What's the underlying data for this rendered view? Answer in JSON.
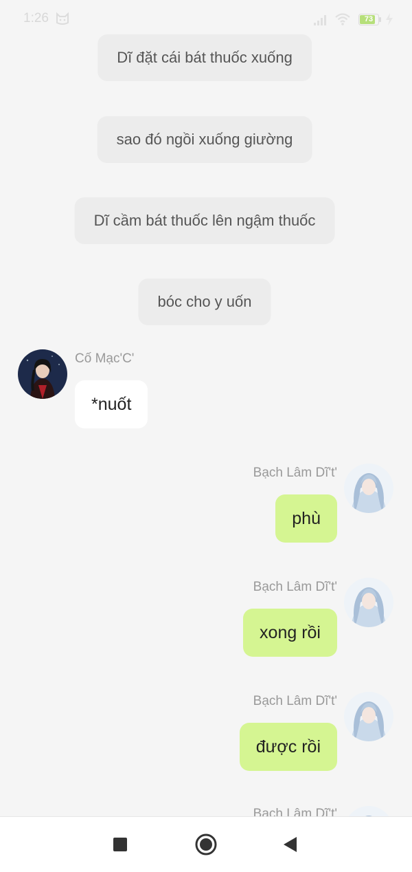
{
  "status_bar": {
    "time": "1:26",
    "battery_level": "73",
    "icons": [
      "cat-icon",
      "signal-icon",
      "wifi-icon",
      "battery-icon",
      "bolt-icon"
    ]
  },
  "system_messages": [
    "Dĩ đặt cái bát thuốc xuống",
    "sao đó ngồi xuống giường",
    "Dĩ cầm bát thuốc lên ngậm thuốc",
    "bóc cho y uốn"
  ],
  "messages": [
    {
      "sender": "Cố Mạc'C'",
      "text": "*nuốt",
      "direction": "incoming"
    },
    {
      "sender": "Bạch Lâm Dĩ't'",
      "text": "phù",
      "direction": "outgoing"
    },
    {
      "sender": "Bạch Lâm Dĩ't'",
      "text": "xong rồi",
      "direction": "outgoing"
    },
    {
      "sender": "Bạch Lâm Dĩ't'",
      "text": "được rồi",
      "direction": "outgoing"
    },
    {
      "sender": "Bạch Lâm Dĩ't'",
      "text": "",
      "direction": "outgoing"
    }
  ],
  "nav_bar": {
    "buttons": [
      "recents-square-icon",
      "home-circle-icon",
      "back-triangle-icon"
    ]
  },
  "colors": {
    "background": "#f5f5f5",
    "system_bubble": "#ececec",
    "incoming_bubble": "#ffffff",
    "outgoing_bubble": "#d5f592",
    "sender_name": "#999999"
  }
}
